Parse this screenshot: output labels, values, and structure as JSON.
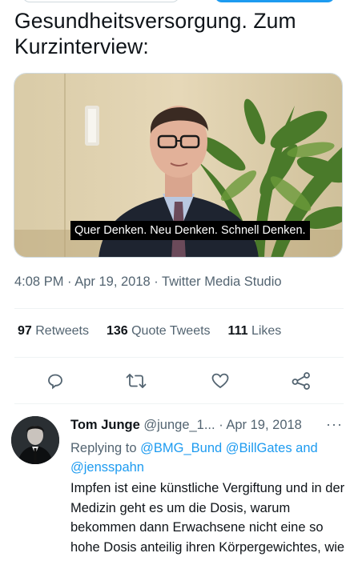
{
  "tweet": {
    "text": "Gesundheitsversorgung. Zum Kurzinterview:",
    "video_subtitle": "Quer Denken. Neu Denken. Schnell Denken.",
    "timestamp": "4:08 PM · Apr 19, 2018 · Twitter Media Studio"
  },
  "stats": {
    "retweets_count": "97",
    "retweets_label": "Retweets",
    "quotes_count": "136",
    "quotes_label": "Quote Tweets",
    "likes_count": "111",
    "likes_label": "Likes"
  },
  "actions": {
    "reply": "reply-icon",
    "retweet": "retweet-icon",
    "like": "heart-icon",
    "share": "share-icon"
  },
  "reply": {
    "name": "Tom Junge",
    "handle": "@junge_1...",
    "date": "· Apr 19, 2018",
    "more": "···",
    "replying_prefix": "Replying to",
    "mention1": "@BMG_Bund",
    "mention2": "@BillGates",
    "and": "and",
    "mention3": "@jensspahn",
    "body": "Impfen ist eine künstliche Vergiftung und in der Medizin geht es um die Dosis, warum bekommen dann Erwachsene nicht eine so hohe Dosis anteilig ihren Körpergewichtes, wie Baby? Und warum wird ignoriert"
  },
  "colors": {
    "accent": "#1d9bf0",
    "secondary_text": "#536471",
    "primary_text": "#0f1419"
  }
}
